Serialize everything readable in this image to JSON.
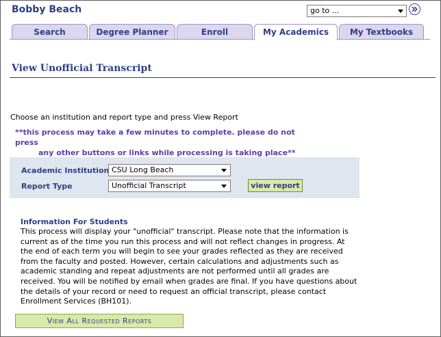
{
  "header": {
    "user_name": "Bobby Beach",
    "goto_select": {
      "value": "go to ...",
      "icon": "chevron-down-icon"
    },
    "goto_button": {
      "icon": "double-chevron-right-icon"
    }
  },
  "tabs": [
    {
      "label": "Search",
      "active": false
    },
    {
      "label": "Degree Planner",
      "active": false
    },
    {
      "label": "Enroll",
      "active": false
    },
    {
      "label": "My Academics",
      "active": true
    },
    {
      "label": "My Textbooks",
      "active": false
    }
  ],
  "page": {
    "title": "View Unofficial Transcript",
    "instructions": "Choose an institution and report type and press View Report",
    "warning_line1": "**this process may take a few minutes to complete. please do not press",
    "warning_line2": "any other buttons or links while processing is taking place**"
  },
  "form": {
    "institution_label": "Academic Institution",
    "institution_value": "CSU Long Beach",
    "report_type_label": "Report Type",
    "report_type_value": "Unofficial Transcript",
    "view_report_label": "view report"
  },
  "info": {
    "heading": "Information For Students",
    "body": "This process will display your \"unofficial\" transcript.  Please note that the information is current as of the time you run this process and will not reflect changes in progress.  At the end of each term you will begin to see your grades reflected as they are received from the faculty and posted.  However, certain calculations and adjustments such as academic standing and repeat adjustments are not performed until all grades are received.  You will be notified by email when grades are final.  If you have questions about the details of your record or need to request an official transcript, please contact Enrollment Services (BH101)."
  },
  "footer": {
    "view_all_label": "View All Requested Reports"
  },
  "colors": {
    "accent": "#2c3f86",
    "tab_bg": "#dcd7ee",
    "panel_bg": "#dfe6ef",
    "button_bg": "#d9e9a9",
    "warning": "#5b3fa6"
  }
}
